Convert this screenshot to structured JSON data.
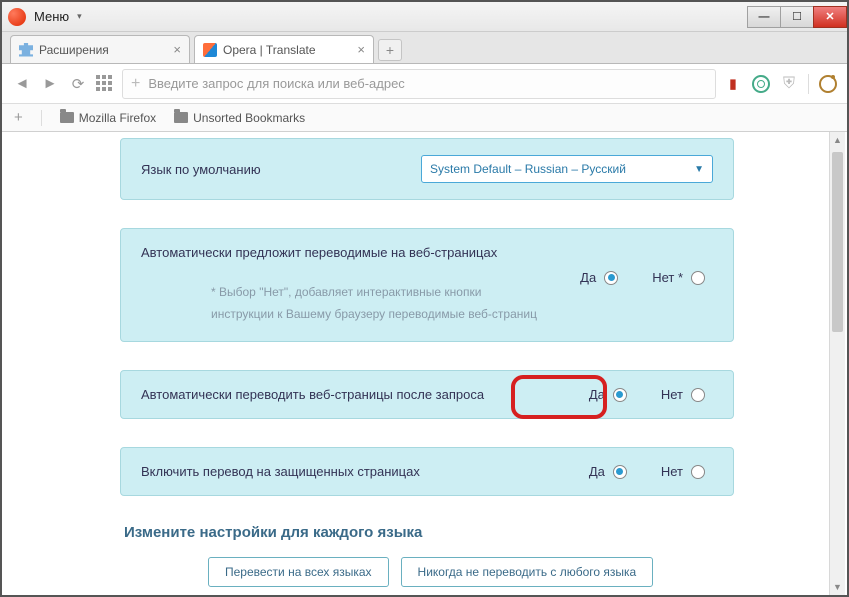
{
  "titlebar": {
    "menu": "Меню"
  },
  "tabs": [
    {
      "label": "Расширения"
    },
    {
      "label": "Opera | Translate"
    }
  ],
  "urlbar": {
    "placeholder": "Введите запрос для поиска или веб-адрес"
  },
  "bookmarks": [
    {
      "label": "Mozilla Firefox"
    },
    {
      "label": "Unsorted Bookmarks"
    }
  ],
  "settings": {
    "default_lang_label": "Язык по умолчанию",
    "default_lang_value": "System Default – Russian – Русский",
    "auto_suggest_label": "Автоматически предложит переводимые на веб-страницах",
    "auto_suggest_note1": "* Выбор \"Нет\", добавляет интерактивные кнопки",
    "auto_suggest_note2": "инструкции к Вашему браузеру переводимые веб-страниц",
    "auto_translate_label": "Автоматически переводить веб-страницы после запроса",
    "secure_pages_label": "Включить перевод на защищенных страницах",
    "yes": "Да",
    "no": "Нет",
    "no_star": "Нет *",
    "section_title": "Измените настройки для каждого языка",
    "btn_translate_all": "Перевести на всех языках",
    "btn_never_translate": "Никогда не переводить с любого языка"
  }
}
